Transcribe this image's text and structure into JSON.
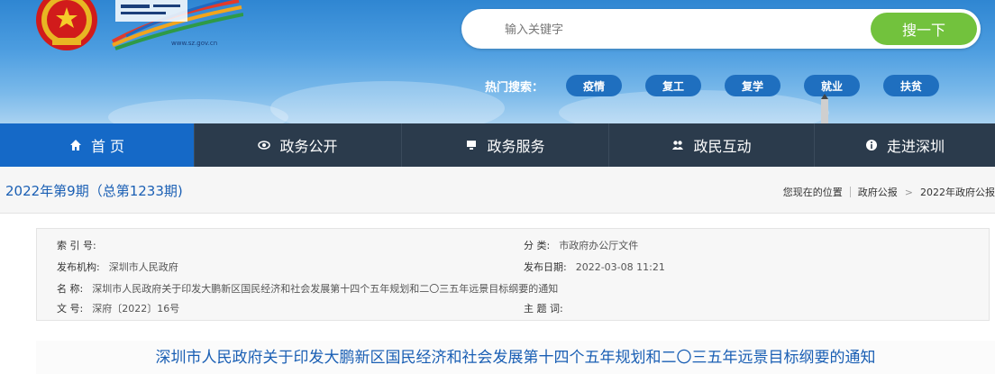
{
  "header": {
    "logo_domain": "www.sz.gov.cn",
    "search": {
      "placeholder": "输入关键字",
      "button_label": "搜一下"
    },
    "hot_label": "热门搜索：",
    "hot_tags": [
      "疫情",
      "复工",
      "复学",
      "就业",
      "扶贫"
    ]
  },
  "nav": {
    "items": [
      {
        "label": "首 页",
        "icon": "home-icon",
        "active": true
      },
      {
        "label": "政务公开",
        "icon": "eye-icon",
        "active": false
      },
      {
        "label": "政务服务",
        "icon": "monitor-icon",
        "active": false
      },
      {
        "label": "政民互动",
        "icon": "people-icon",
        "active": false
      },
      {
        "label": "走进深圳",
        "icon": "info-icon",
        "active": false
      }
    ]
  },
  "issue": {
    "title": "2022年第9期（总第1233期)",
    "breadcrumb": {
      "location_label": "您现在的位置",
      "level1": "政府公报",
      "separator": ">",
      "level2": "2022年政府公报"
    }
  },
  "info": {
    "index_no_label": "索 引 号:",
    "index_no_value": "",
    "category_label": "分 类:",
    "category_value": "市政府办公厅文件",
    "publisher_label": "发布机构:",
    "publisher_value": "深圳市人民政府",
    "date_label": "发布日期:",
    "date_value": "2022-03-08 11:21",
    "name_label": "名 称:",
    "name_value": "深圳市人民政府关于印发大鹏新区国民经济和社会发展第十四个五年规划和二〇三五年远景目标纲要的通知",
    "doc_no_label": "文 号:",
    "doc_no_value": "深府〔2022〕16号",
    "subject_label": "主 题 词:",
    "subject_value": ""
  },
  "document": {
    "title": "深圳市人民政府关于印发大鹏新区国民经济和社会发展第十四个五年规划和二〇三五年远景目标纲要的通知"
  },
  "colors": {
    "nav_bg": "#2b3b4c",
    "nav_active": "#1569c7",
    "accent_blue": "#1a5fb4",
    "search_green": "#72c23d"
  }
}
